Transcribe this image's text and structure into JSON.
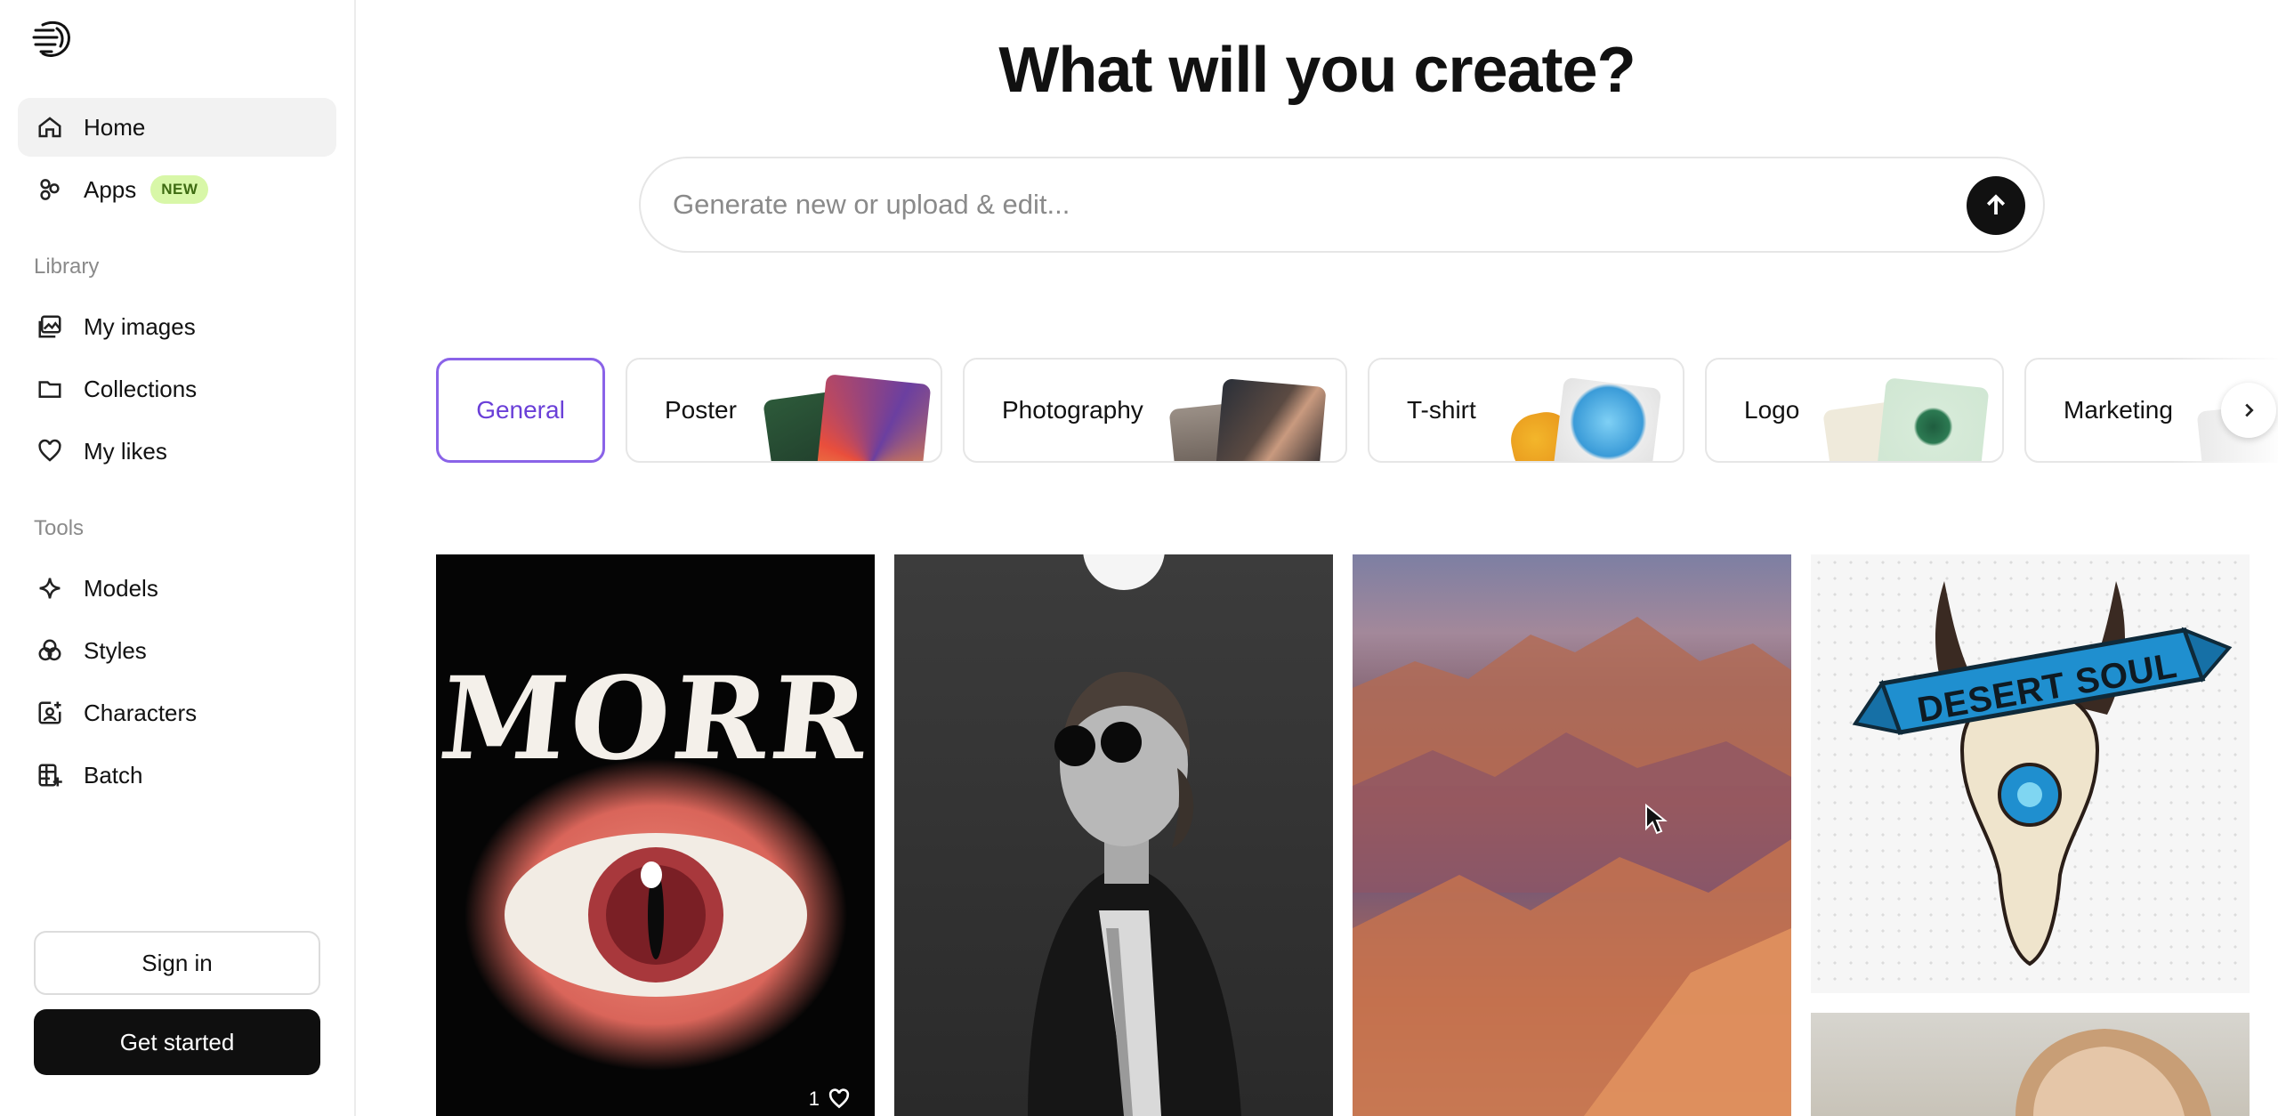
{
  "sidebar": {
    "nav": [
      {
        "label": "Home",
        "icon": "home-icon"
      },
      {
        "label": "Apps",
        "icon": "apps-icon",
        "badge": "NEW"
      }
    ],
    "library_label": "Library",
    "library": [
      {
        "label": "My images",
        "icon": "images-icon"
      },
      {
        "label": "Collections",
        "icon": "folder-icon"
      },
      {
        "label": "My likes",
        "icon": "heart-icon"
      }
    ],
    "tools_label": "Tools",
    "tools": [
      {
        "label": "Models",
        "icon": "sparkle-icon"
      },
      {
        "label": "Styles",
        "icon": "styles-icon"
      },
      {
        "label": "Characters",
        "icon": "character-icon"
      },
      {
        "label": "Batch",
        "icon": "batch-icon"
      }
    ],
    "sign_in": "Sign in",
    "get_started": "Get started"
  },
  "main": {
    "title": "What will you create?",
    "search_placeholder": "Generate new or upload & edit...",
    "categories": [
      "General",
      "Poster",
      "Photography",
      "T-shirt",
      "Logo",
      "Marketing"
    ],
    "gallery": {
      "card1": {
        "text": "MORR",
        "likes": "1"
      },
      "card4": {
        "banner": "DESERT SOUL"
      }
    }
  },
  "colors": {
    "accent": "#8a63e8",
    "badge_bg": "#d8f7a8",
    "dark": "#111111"
  }
}
